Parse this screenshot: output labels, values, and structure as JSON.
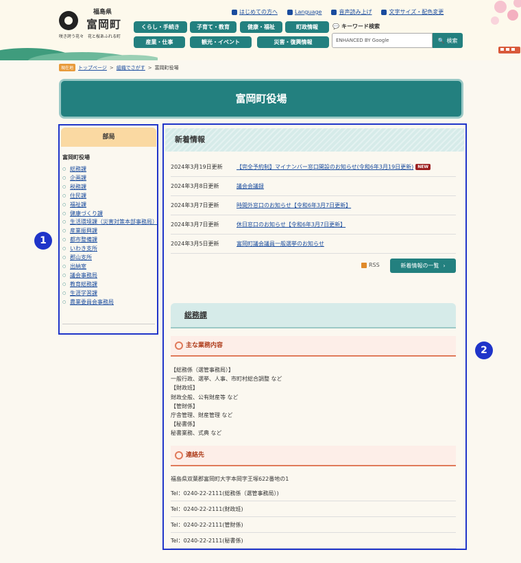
{
  "header": {
    "prefecture": "福島県",
    "town_name": "富岡町",
    "catchphrase": "咲き誇う花々　花と桜あふれる町",
    "top_links": [
      "はじめての方へ",
      "Language",
      "音声読み上げ",
      "文字サイズ・配色変更"
    ],
    "nav": [
      [
        "くらし・手続き",
        "子育て・教育",
        "健康・福祉",
        "町政情報"
      ],
      [
        "産業・仕事",
        "観光・イベント",
        "災害・復興情報"
      ]
    ],
    "keyword_label": "キーワード検索",
    "search_placeholder": "ENHANCED BY Google",
    "search_button": "検索"
  },
  "breadcrumb": {
    "here_label": "現在地",
    "items": [
      "トップページ",
      "組織でさがす",
      "富岡町役場"
    ],
    "separator": ">"
  },
  "page_title": "富岡町役場",
  "sidebar": {
    "heading": "部局",
    "subheading": "富岡町役場",
    "items": [
      "総務課",
      "企画課",
      "税務課",
      "住民課",
      "福祉課",
      "健康づくり課",
      "生活環境課（災害対策本部事務局）",
      "産業振興課",
      "都市整備課",
      "いわき支所",
      "郡山支所",
      "出納室",
      "議会事務局",
      "教育総務課",
      "生涯学習課",
      "農業委員会事務局"
    ]
  },
  "news": {
    "heading": "新着情報",
    "items": [
      {
        "date": "2024年3月19日更新",
        "title": "【完全予約制】マイナンバー窓口開設のお知らせ(令和6年3月19日更新)",
        "badge": "NEW"
      },
      {
        "date": "2024年3月8日更新",
        "title": "議会会議録",
        "badge": ""
      },
      {
        "date": "2024年3月7日更新",
        "title": "時間外窓口のお知らせ【令和6年3月7日更新】",
        "badge": ""
      },
      {
        "date": "2024年3月7日更新",
        "title": "休日窓口のお知らせ【令和6年3月7日更新】",
        "badge": ""
      },
      {
        "date": "2024年3月5日更新",
        "title": "富岡町議会議員一般選挙のお知らせ",
        "badge": ""
      }
    ],
    "rss": "RSS",
    "list_button": "新着情報の一覧"
  },
  "department": {
    "name": "総務課",
    "duties_heading": "主な業務内容",
    "duties": [
      "【総務係（選管事務局）】",
      "一般行政、選挙、人事、市町村総合調整 など",
      "【財政班】",
      "財政全般、公有財産等 など",
      "【管財係】",
      "庁舎管理、財産管理 など",
      "【秘書係】",
      "秘書業務、式典 など"
    ],
    "contact_heading": "連絡先",
    "address": "福島県双葉郡富岡町大字本岡字王塚622番地の1",
    "tels": [
      "Tel：0240-22-2111(総務係（選管事務局）)",
      "Tel：0240-22-2111(財政班)",
      "Tel：0240-22-2111(管財係)",
      "Tel：0240-22-2111(秘書係)"
    ]
  },
  "markers": [
    "1",
    "2"
  ],
  "colors": {
    "teal": "#23807f",
    "highlight_blue": "#1f34c9",
    "sidebar_header": "#fad9a2",
    "section_accent": "#e07a5a"
  }
}
